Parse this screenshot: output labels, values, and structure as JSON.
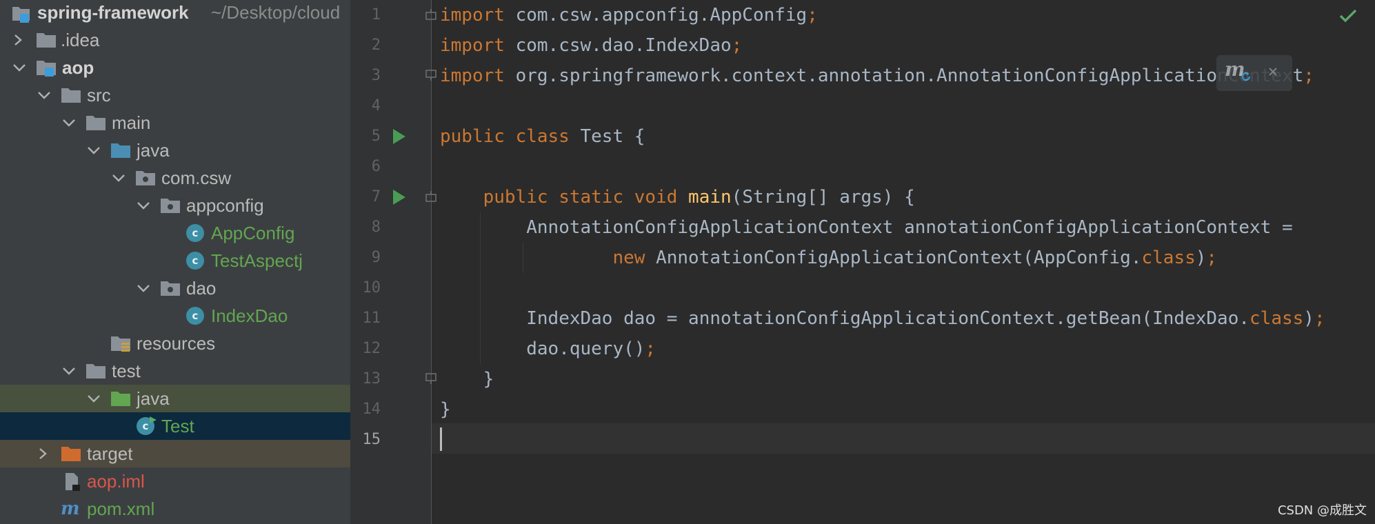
{
  "project_tree": {
    "root": {
      "name": "spring-framework",
      "path": "~/Desktop/cloud"
    },
    "items": [
      {
        "label": ".idea"
      },
      {
        "label": "aop"
      },
      {
        "label": "src"
      },
      {
        "label": "main"
      },
      {
        "label": "java"
      },
      {
        "label": "com.csw"
      },
      {
        "label": "appconfig"
      },
      {
        "label": "AppConfig",
        "icon_text": "c"
      },
      {
        "label": "TestAspectj",
        "icon_text": "c"
      },
      {
        "label": "dao"
      },
      {
        "label": "IndexDao",
        "icon_text": "c"
      },
      {
        "label": "resources"
      },
      {
        "label": "test"
      },
      {
        "label": "java"
      },
      {
        "label": "Test",
        "icon_text": "c"
      },
      {
        "label": "target"
      },
      {
        "label": "aop.iml"
      },
      {
        "label": "pom.xml",
        "icon_text": "m"
      }
    ]
  },
  "editor": {
    "line_numbers": [
      "1",
      "2",
      "3",
      "4",
      "5",
      "6",
      "7",
      "8",
      "9",
      "10",
      "11",
      "12",
      "13",
      "14",
      "15"
    ],
    "lines": {
      "l1": {
        "kw": "import",
        "text": " com.csw.appconfig.AppConfig",
        "semi": ";"
      },
      "l2": {
        "kw": "import",
        "text": " com.csw.dao.IndexDao",
        "semi": ";"
      },
      "l3": {
        "kw": "import",
        "text": " org.springframework.context.annotation.AnnotationConfigApplicationContext",
        "semi": ";"
      },
      "l5": {
        "kw": "public class",
        "text": " Test {"
      },
      "l7": {
        "kw": "public static void",
        "fn": "main",
        "text": "(String[] args) {"
      },
      "l8": {
        "text": "AnnotationConfigApplicationContext annotationConfigApplicationContext ="
      },
      "l9": {
        "kw": "new",
        "text": " AnnotationConfigApplicationContext(AppConfig.",
        "kw2": "class",
        "end": ")",
        "semi": ";"
      },
      "l11": {
        "text": "IndexDao dao = annotationConfigApplicationContext.getBean(IndexDao.",
        "kw2": "class",
        "end": ")",
        "semi": ";"
      },
      "l12": {
        "text": "dao.query()",
        "semi": ";"
      },
      "l13": {
        "text": "}"
      },
      "l14": {
        "text": "}"
      }
    },
    "popup_icon_text": "m"
  },
  "watermark": "CSDN @成胜文",
  "colors": {
    "keyword": "#cc7832",
    "method": "#ffc66d",
    "plain": "#a9b7c6",
    "class_icon": "#3d8fa6",
    "green_file": "#62a651",
    "red_file": "#d8574a"
  }
}
